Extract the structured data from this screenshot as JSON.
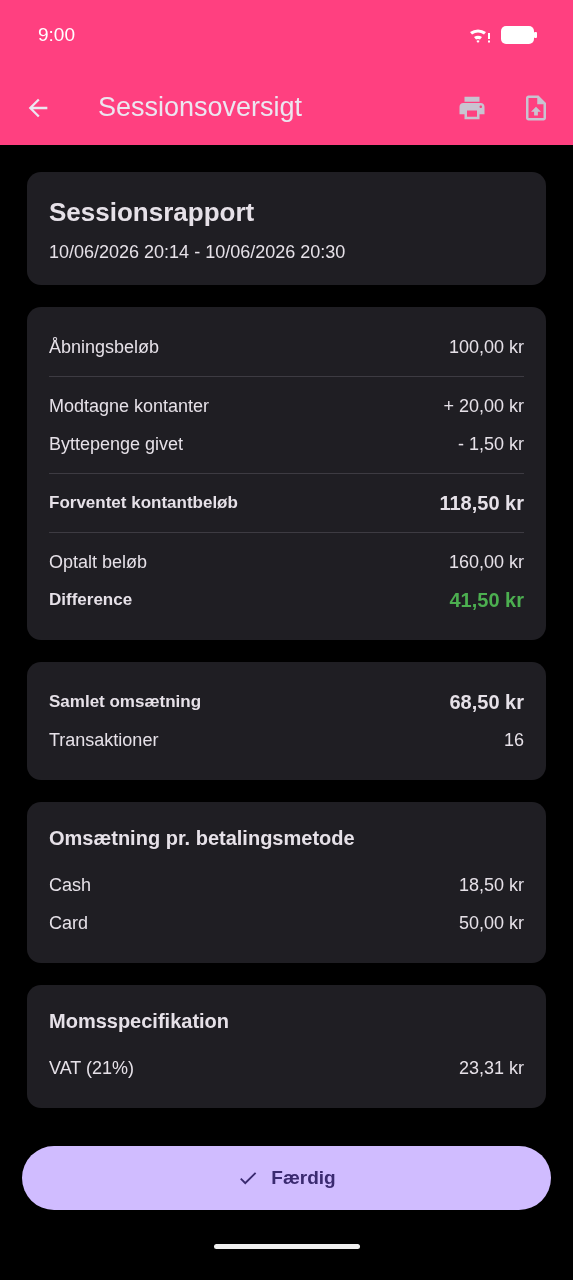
{
  "status_bar": {
    "time": "9:00"
  },
  "app_bar": {
    "title": "Sessionsoversigt"
  },
  "summary": {
    "title": "Sessionsrapport",
    "period": "10/06/2026 20:14 - 10/06/2026 20:30"
  },
  "sections": [
    {
      "rows": [
        {
          "label": "Åbningsbeløb",
          "value": "100,00 kr",
          "kind": "plain",
          "divider_before": false
        },
        {
          "label": "Modtagne kontanter",
          "value": "+ 20,00 kr",
          "kind": "plain",
          "divider_before": true
        },
        {
          "label": "Byttepenge givet",
          "value": "- 1,50 kr",
          "kind": "plain",
          "divider_before": false
        },
        {
          "label": "Forventet kontantbeløb",
          "value": "118,50 kr",
          "kind": "total",
          "divider_before": true
        },
        {
          "label": "Optalt beløb",
          "value": "160,00 kr",
          "kind": "plain",
          "divider_before": true
        },
        {
          "label": "Difference",
          "value": "41,50 kr",
          "kind": "positive",
          "divider_before": false
        }
      ]
    },
    {
      "rows": [
        {
          "label": "Samlet omsætning",
          "value": "68,50 kr",
          "kind": "total",
          "divider_before": false
        },
        {
          "label": "Transaktioner",
          "value": "16",
          "kind": "plain",
          "divider_before": false
        }
      ]
    },
    {
      "title": "Omsætning pr. betalingsmetode",
      "rows": [
        {
          "label": "Cash",
          "value": "18,50 kr",
          "kind": "plain",
          "divider_before": false
        },
        {
          "label": "Card",
          "value": "50,00 kr",
          "kind": "plain",
          "divider_before": false
        }
      ]
    },
    {
      "title": "Momsspecifikation",
      "rows": [
        {
          "label": "VAT (21%)",
          "value": "23,31 kr",
          "kind": "plain",
          "divider_before": false
        }
      ]
    }
  ],
  "done_button": {
    "label": "Færdig"
  }
}
